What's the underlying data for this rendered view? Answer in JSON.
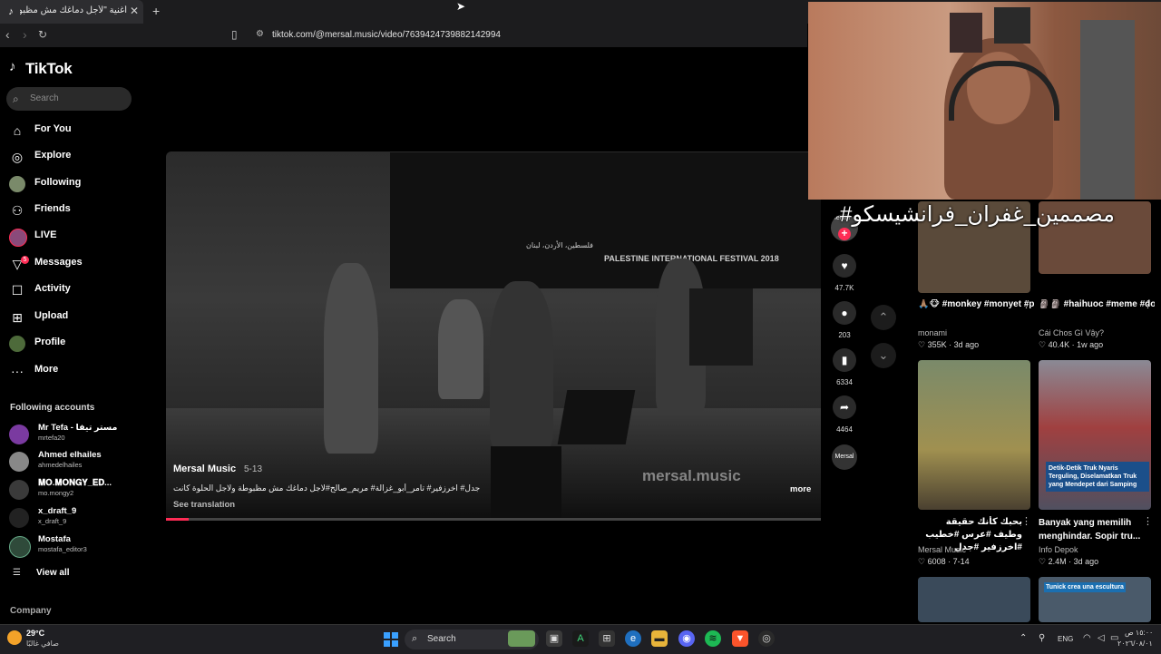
{
  "browser": {
    "tab_title": "أغنية \"لأجل دماغك مش مظبوطة\"",
    "tab_favicon": "tiktok-icon",
    "url": "tiktok.com/@mersal.music/video/7639424739882142994"
  },
  "sidebar": {
    "logo": "TikTok",
    "search_placeholder": "Search",
    "nav": [
      {
        "label": "For You",
        "icon": "home-icon"
      },
      {
        "label": "Explore",
        "icon": "compass-icon"
      },
      {
        "label": "Following",
        "icon": "following-avatar-icon"
      },
      {
        "label": "Friends",
        "icon": "friends-icon"
      },
      {
        "label": "LIVE",
        "icon": "live-icon"
      },
      {
        "label": "Messages",
        "icon": "messages-icon",
        "badge": "5"
      },
      {
        "label": "Activity",
        "icon": "activity-icon"
      },
      {
        "label": "Upload",
        "icon": "upload-icon"
      },
      {
        "label": "Profile",
        "icon": "profile-icon"
      },
      {
        "label": "More",
        "icon": "more-icon"
      }
    ],
    "following_heading": "Following accounts",
    "accounts": [
      {
        "name": "Mr Tefa - مستر تيفا",
        "handle": "mrtefa20"
      },
      {
        "name": "Ahmed elhailes",
        "handle": "ahmedelhailes"
      },
      {
        "name": "𝐌𝐎.𝐌𝐎𝐍𝐆𝐘_𝐄𝐃...",
        "handle": "mo.mongy2"
      },
      {
        "name": "x_draft_9",
        "handle": "x_draft_9"
      },
      {
        "name": "Mostafa",
        "handle": "mostafa_editor3"
      }
    ],
    "view_all": "View all",
    "company": "Company"
  },
  "video": {
    "author": "Mersal Music",
    "date": "5-13",
    "caption": "جدل# اخرزفير# تامر_أبو_غزالة# مريم_صالح#لاجل دماغك مش مظبوطة ولاجل الحلوة كانت",
    "see_translation": "See translation",
    "more": "more",
    "watermark": "mersal.music",
    "festival_text": "PALESTINE INTERNATIONAL FESTIVAL 2018",
    "festival_text_ar": "فلسطين، الأردن، لبنان",
    "progress": 0.035
  },
  "actions": {
    "author_label": "Mersal",
    "likes": "47.7K",
    "comments": "203",
    "saves": "6334",
    "shares": "4464",
    "disc_label": "Mersal"
  },
  "grid": [
    {
      "title": "🙏🏽🐵 #monkey #monyet #pet",
      "author": "monami",
      "stats": "♡ 355K · 3d ago"
    },
    {
      "title": "🗿🗿 #haihuoc #meme #douyin #viral",
      "author": "Cái Chos Gì Vậy?",
      "stats": "♡ 40.4K · 1w ago"
    },
    {
      "title": "بحبك كأنك حقيقة وطيف #عرس #خطيب #اخرزفير #جدل",
      "author": "Mersal Music",
      "stats": "♡ 6008 · 7-14"
    },
    {
      "title": "Banyak yang memilih menghindar. Sopir tru...",
      "author": "Info Depok",
      "stats": "♡ 2.4M · 3d ago",
      "thumb_text": "Detik-Detik Truk Nyaris Terguling, Diselamatkan Truk yang Mendepet dari Samping"
    },
    {
      "thumb_text": "Tunick crea una escultura"
    }
  ],
  "webcam_overlay": "مصممين_غفران_فرانشيسكو#",
  "taskbar": {
    "weather_temp": "29°C",
    "weather_desc": "صافي غالبًا",
    "search_label": "Search",
    "lang": "ENG",
    "time": "١٥:٠٠ ص",
    "date": "٢٠٢٦/٠٨/٠١"
  },
  "colors": {
    "accent": "#fe2c55",
    "background": "#000000",
    "sidebar_search": "#2a2a2a"
  }
}
